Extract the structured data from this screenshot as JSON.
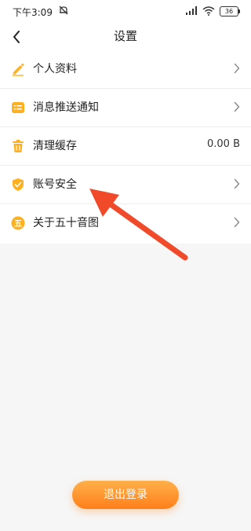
{
  "status_bar": {
    "time": "下午3:09",
    "battery": "36",
    "icons": [
      "mute-icon",
      "signal-icon",
      "wifi-icon",
      "battery-icon"
    ]
  },
  "header": {
    "title": "设置",
    "back_icon": "chevron-left-icon"
  },
  "settings": {
    "items": [
      {
        "label": "个人资料",
        "icon": "pencil-icon",
        "trailing": "chevron"
      },
      {
        "label": "消息推送通知",
        "icon": "message-list-icon",
        "trailing": "chevron"
      },
      {
        "label": "清理缓存",
        "icon": "trash-icon",
        "value": "0.00 B"
      },
      {
        "label": "账号安全",
        "icon": "shield-check-icon",
        "trailing": "chevron"
      },
      {
        "label": "关于五十音图",
        "icon": "app-logo-icon",
        "logo_char": "五",
        "trailing": "chevron"
      }
    ]
  },
  "logout": {
    "label": "退出登录"
  },
  "colors": {
    "accent": "#ffb020",
    "button_gradient_top": "#ffb04a",
    "button_gradient_bottom": "#ff7f1a",
    "annotation_arrow": "#f04a2a"
  }
}
